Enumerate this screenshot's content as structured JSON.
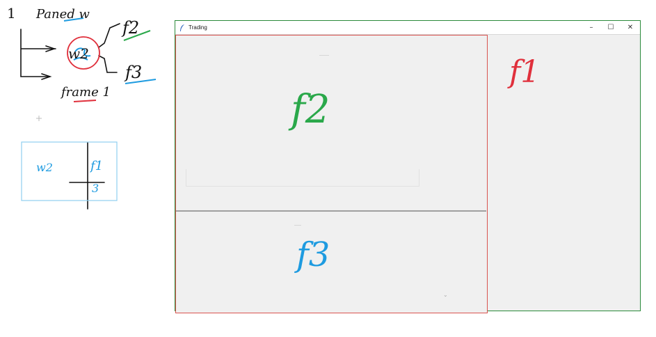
{
  "window": {
    "title": "Trading",
    "buttons": {
      "minimize": "–",
      "maximize": "☐",
      "close": "✕"
    }
  },
  "annotations": {
    "f1": "f1",
    "f2": "f2",
    "f3": "f3",
    "colors": {
      "f1": "#e0303c",
      "f2": "#2aa84a",
      "f3": "#1e9be0",
      "sketch": "#111111"
    }
  },
  "sketch": {
    "line1": "1",
    "paned": "Paned w",
    "w2": "w2",
    "f2": "f2",
    "f3": "f3",
    "frame1": "frame 1",
    "box_w2": "w2",
    "box_f1": "f1",
    "box_f3": "3"
  }
}
